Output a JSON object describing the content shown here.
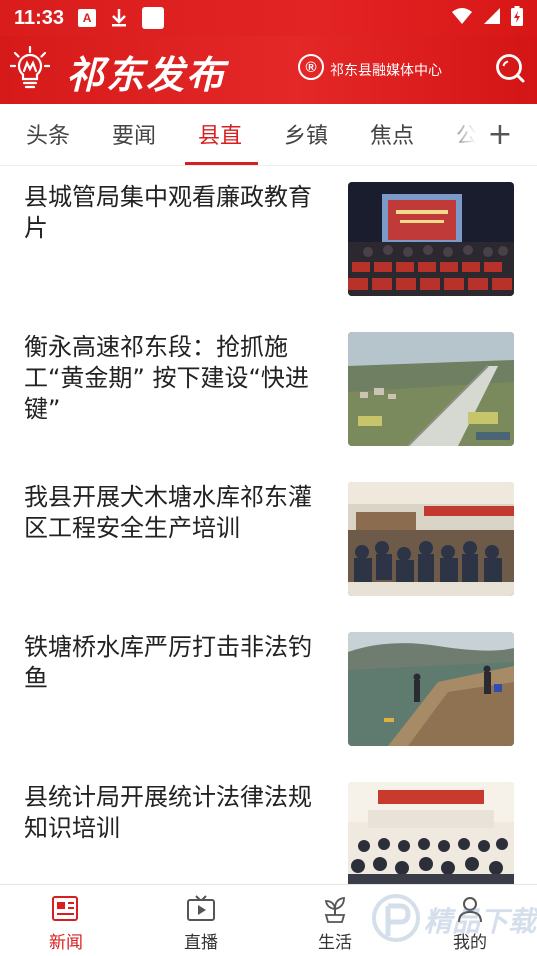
{
  "status_bar": {
    "time": "11:33",
    "a_icon_letter": "A",
    "icons": [
      "a-notification-icon",
      "download-icon",
      "square-notification-icon",
      "wifi-icon",
      "signal-icon",
      "battery-charging-icon"
    ]
  },
  "header": {
    "logo_icon": "lightbulb-icon",
    "brand": "祁东发布",
    "registered_mark": "®",
    "media_center": "祁东县融媒体中心",
    "search_icon": "search-icon",
    "brand_color": "#d81e1e"
  },
  "tabs": {
    "items": [
      {
        "label": "头条"
      },
      {
        "label": "要闻"
      },
      {
        "label": "县直"
      },
      {
        "label": "乡镇"
      },
      {
        "label": "焦点"
      },
      {
        "label": "公"
      }
    ],
    "active_index": 2,
    "add_label": "+"
  },
  "news": [
    {
      "title": "县城管局集中观看廉政教育片",
      "thumb": "auditorium-screen-photo"
    },
    {
      "title": "衡永高速祁东段：抢抓施工“黄金期” 按下建设“快进键”",
      "thumb": "highway-aerial-photo"
    },
    {
      "title": "我县开展犬木塘水库祁东灌区工程安全生产培训",
      "thumb": "meeting-room-photo"
    },
    {
      "title": "铁塘桥水库严厉打击非法钓鱼",
      "thumb": "reservoir-shore-photo"
    },
    {
      "title": "县统计局开展统计法律法规知识培训",
      "thumb": "training-hall-photo"
    }
  ],
  "bottom_nav": {
    "items": [
      {
        "label": "新闻",
        "icon": "newspaper-icon",
        "active": true
      },
      {
        "label": "直播",
        "icon": "tv-play-icon",
        "active": false
      },
      {
        "label": "生活",
        "icon": "sprout-icon",
        "active": false
      },
      {
        "label": "我的",
        "icon": "user-icon",
        "active": false
      }
    ]
  },
  "watermark": {
    "text": "精品下载"
  }
}
